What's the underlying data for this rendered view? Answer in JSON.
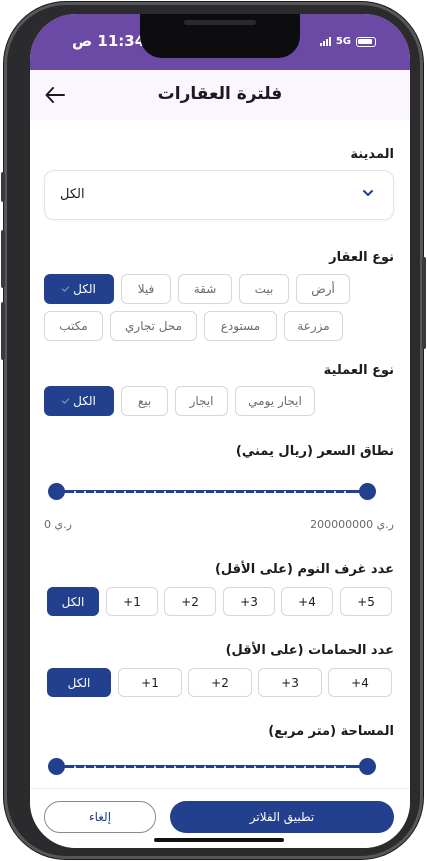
{
  "status_bar": {
    "time": "11:34 ص",
    "network": "5G"
  },
  "header": {
    "title": "فلترة العقارات",
    "back_icon": "arrow-left-icon"
  },
  "city": {
    "label": "المدينة",
    "value": "الكل"
  },
  "property_type": {
    "label": "نوع العقار",
    "options": [
      "الكل",
      "فيلا",
      "شقة",
      "بيت",
      "أرض",
      "مكتب",
      "محل تجاري",
      "مستودع",
      "مزرعة"
    ],
    "selected": "الكل"
  },
  "operation_type": {
    "label": "نوع العملية",
    "options": [
      "الكل",
      "بيع",
      "ايجار",
      "ايجار يومي"
    ],
    "selected": "الكل"
  },
  "price_range": {
    "label": "نطاق السعر (ريال يمني)",
    "min_label": "ر.ي 0",
    "max_label": "ر.ي 200000000",
    "min": 0,
    "max": 200000000
  },
  "bedrooms": {
    "label": "عدد غرف النوم (على الأقل)",
    "options": [
      "الكل",
      "1+",
      "2+",
      "3+",
      "4+",
      "5+"
    ],
    "selected": "الكل"
  },
  "bathrooms": {
    "label": "عدد الحمامات (على الأقل)",
    "options": [
      "الكل",
      "1+",
      "2+",
      "3+",
      "4+"
    ],
    "selected": "الكل"
  },
  "area": {
    "label": "المساحة (متر مربع)"
  },
  "footer": {
    "apply": "تطبيق الفلاتر",
    "cancel": "إلغاء"
  },
  "colors": {
    "primary": "#23408e",
    "status_bar": "#6b4aa6",
    "header_bg": "#fbf5fd"
  }
}
